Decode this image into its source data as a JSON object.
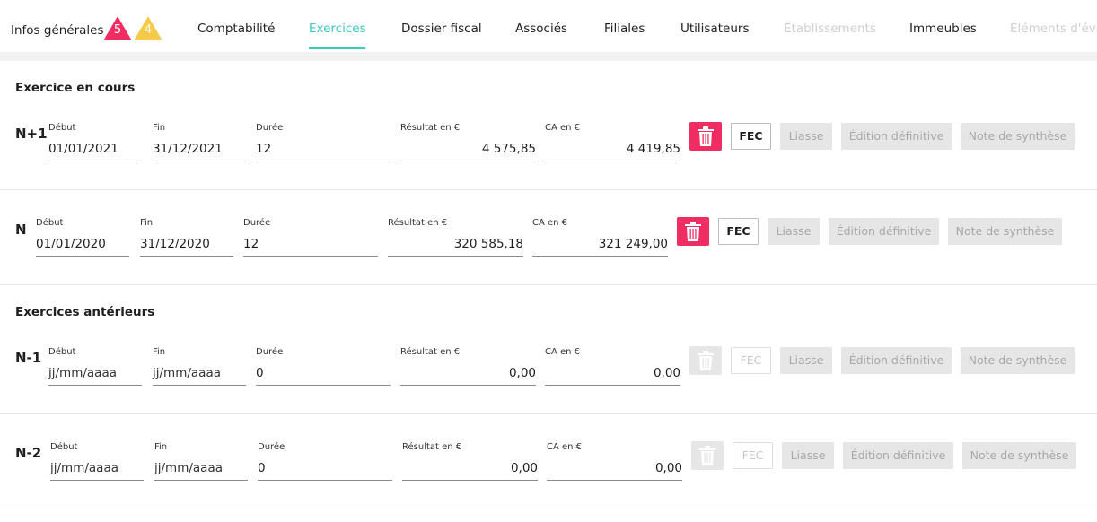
{
  "tabs": [
    {
      "label": "Infos générales",
      "state": "normal"
    },
    {
      "label": "Comptabilité",
      "state": "normal"
    },
    {
      "label": "Exercices",
      "state": "active"
    },
    {
      "label": "Dossier fiscal",
      "state": "normal"
    },
    {
      "label": "Associés",
      "state": "normal"
    },
    {
      "label": "Filiales",
      "state": "normal"
    },
    {
      "label": "Utilisateurs",
      "state": "normal"
    },
    {
      "label": "Établissements",
      "state": "disabled"
    },
    {
      "label": "Immeubles",
      "state": "normal"
    },
    {
      "label": "Éléments d'éva",
      "state": "disabled"
    }
  ],
  "badges": {
    "errors": "5",
    "warnings": "4",
    "error_color": "#ef2d63",
    "warning_color": "#f7c948"
  },
  "accent": "#3fc7c2",
  "sections": {
    "current": "Exercice en cours",
    "previous": "Exercices antérieurs"
  },
  "field_labels": {
    "debut": "Début",
    "fin": "Fin",
    "duree": "Durée",
    "resultat": "Résultat en €",
    "ca": "CA en €"
  },
  "buttons": {
    "fec": "FEC",
    "liasse": "Liasse",
    "edition": "Édition définitive",
    "note": "Note de synthèse"
  },
  "rows": [
    {
      "label": "N+1",
      "debut": "01/01/2021",
      "fin": "31/12/2021",
      "duree": "12",
      "resultat": "4 575,85",
      "ca": "4 419,85"
    },
    {
      "label": "N",
      "debut": "01/01/2020",
      "fin": "31/12/2020",
      "duree": "12",
      "resultat": "320 585,18",
      "ca": "321 249,00"
    },
    {
      "label": "N-1",
      "debut": "jj/mm/aaaa",
      "fin": "jj/mm/aaaa",
      "duree": "0",
      "resultat": "0,00",
      "ca": "0,00"
    },
    {
      "label": "N-2",
      "debut": "jj/mm/aaaa",
      "fin": "jj/mm/aaaa",
      "duree": "0",
      "resultat": "0,00",
      "ca": "0,00"
    }
  ]
}
